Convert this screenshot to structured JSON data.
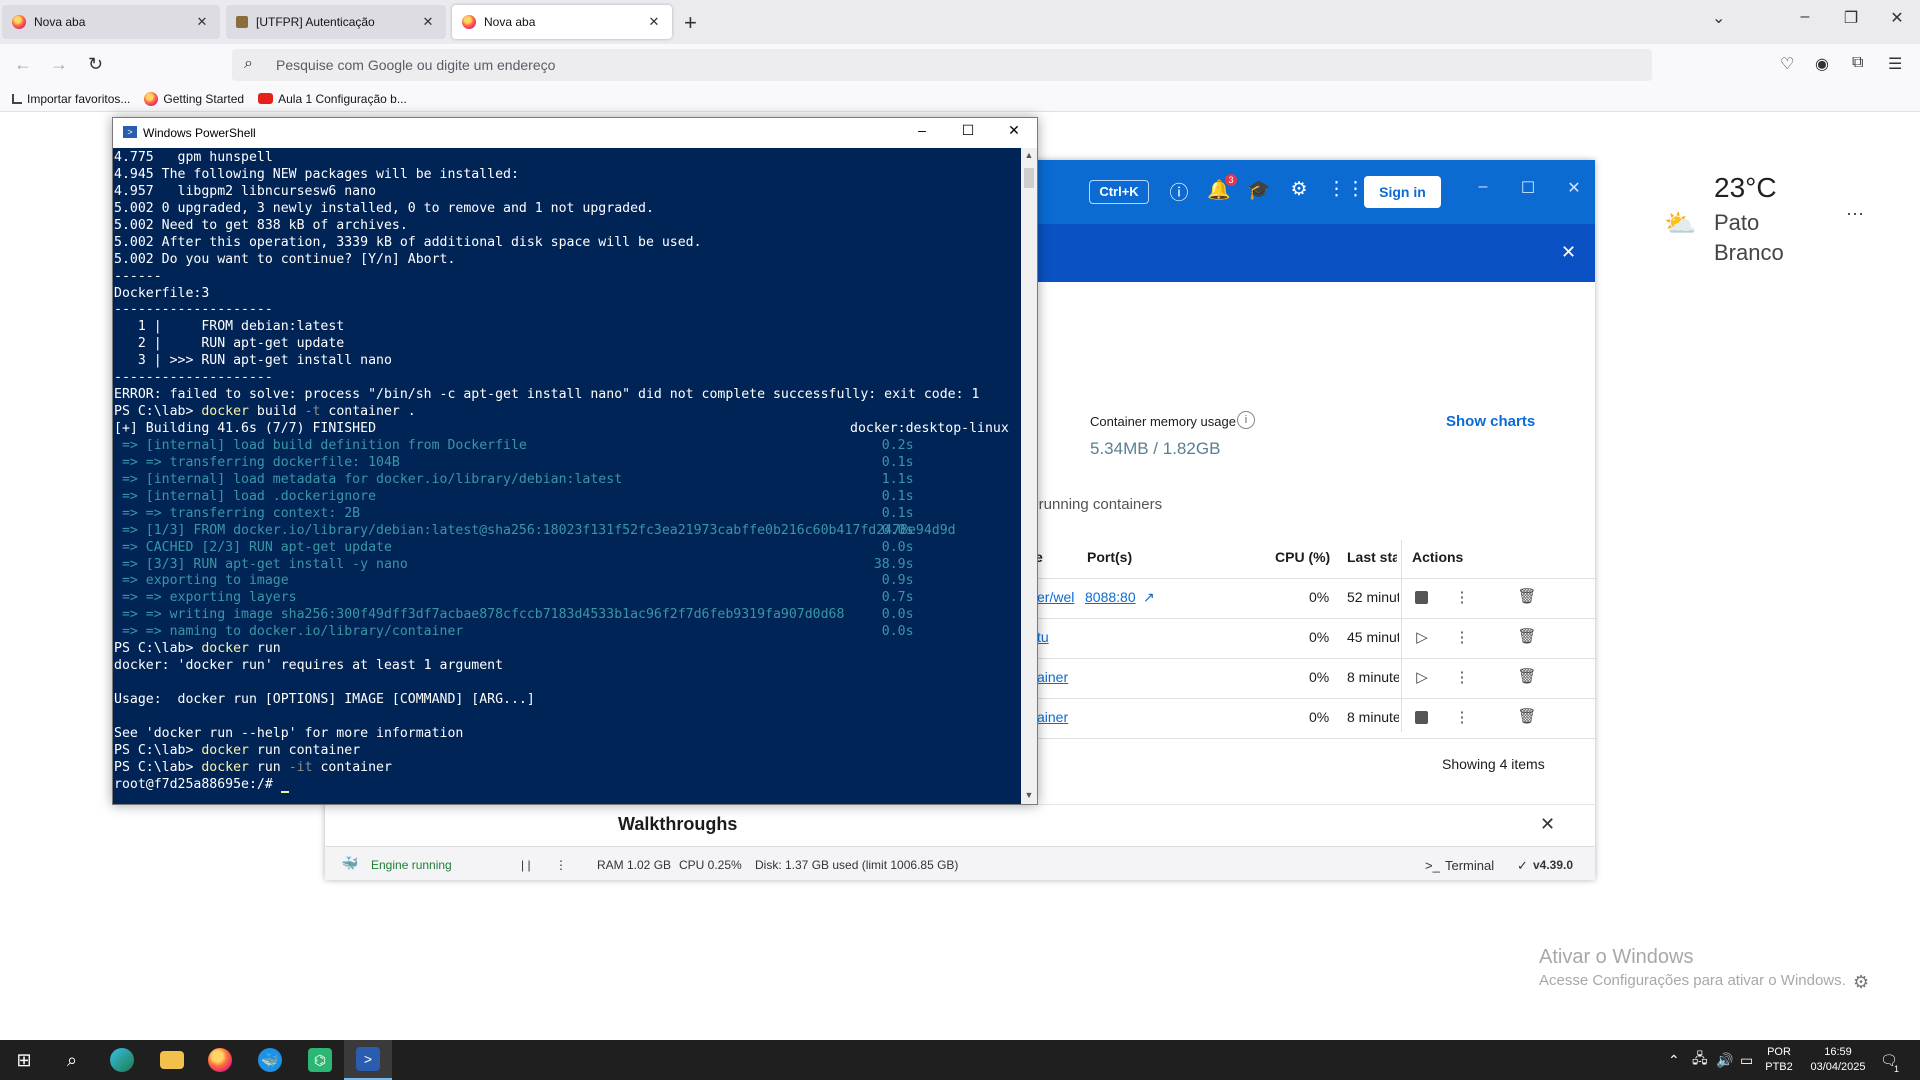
{
  "browser": {
    "tabs": [
      {
        "title": "Nova aba",
        "active": false
      },
      {
        "title": "[UTFPR] Autenticação",
        "active": false
      },
      {
        "title": "Nova aba",
        "active": true
      }
    ],
    "new_tab": "+",
    "url_placeholder": "Pesquise com Google ou digite um endereço",
    "bookmarks": [
      "Importar favoritos...",
      "Getting Started",
      "Aula 1 Configuração b..."
    ]
  },
  "docker": {
    "shortcut": "Ctrl+K",
    "notification_count": "3",
    "sign_in": "Sign in",
    "memory_label": "Container memory usage",
    "memory_value": "5.34MB / 1.82GB",
    "show_charts": "Show charts",
    "running_filter": "v running containers",
    "columns": [
      "e",
      "Port(s)",
      "CPU (%)",
      "Last star",
      "Actions"
    ],
    "rows": [
      {
        "name": "er/wel",
        "port": "8088:80",
        "cpu": "0%",
        "last": "52 minut",
        "state": "running"
      },
      {
        "name": "tu",
        "port": "",
        "cpu": "0%",
        "last": "45 minut",
        "state": "stopped"
      },
      {
        "name": "ainer",
        "port": "",
        "cpu": "0%",
        "last": "8 minute",
        "state": "stopped"
      },
      {
        "name": "ainer",
        "port": "",
        "cpu": "0%",
        "last": "8 minute",
        "state": "running"
      }
    ],
    "showing": "Showing 4 items",
    "walkthroughs": "Walkthroughs",
    "status": {
      "engine": "Engine running",
      "ram": "RAM 1.02 GB",
      "cpu": "CPU 0.25%",
      "disk": "Disk: 1.37 GB used (limit 1006.85 GB)",
      "terminal": "Terminal",
      "version": "v4.39.0"
    }
  },
  "weather": {
    "temp": "23°C",
    "city": "Pato Branco"
  },
  "powershell": {
    "title": "Windows PowerShell",
    "lines": [
      {
        "t": "4.775   gpm hunspell"
      },
      {
        "t": "4.945 The following NEW packages will be installed:"
      },
      {
        "t": "4.957   libgpm2 libncursesw6 nano"
      },
      {
        "t": "5.002 0 upgraded, 3 newly installed, 0 to remove and 1 not upgraded."
      },
      {
        "t": "5.002 Need to get 838 kB of archives."
      },
      {
        "t": "5.002 After this operation, 3339 kB of additional disk space will be used."
      },
      {
        "t": "5.002 Do you want to continue? [Y/n] Abort."
      },
      {
        "t": "------"
      },
      {
        "t": "Dockerfile:3"
      },
      {
        "t": "--------------------"
      },
      {
        "t": "   1 |     FROM debian:latest"
      },
      {
        "t": "   2 |     RUN apt-get update"
      },
      {
        "t": "   3 | >>> RUN apt-get install nano"
      },
      {
        "t": "--------------------"
      },
      {
        "t": "ERROR: failed to solve: process \"/bin/sh -c apt-get install nano\" did not complete successfully: exit code: 1"
      },
      {
        "t": "PS C:\\lab> ",
        "cmd": "docker",
        "args": [
          {
            "t": " build "
          },
          {
            "t": "-t",
            "flag": true
          },
          {
            "t": " container ."
          }
        ]
      },
      {
        "t": "[+] Building 41.6s (7/7) FINISHED",
        "rt": "docker:desktop-linux"
      },
      {
        "t": " => [internal] load build definition from Dockerfile",
        "rt": "    0.2s",
        "teal": true
      },
      {
        "t": " => => transferring dockerfile: 104B",
        "rt": "    0.1s",
        "teal": true
      },
      {
        "t": " => [internal] load metadata for docker.io/library/debian:latest",
        "rt": "    1.1s",
        "teal": true
      },
      {
        "t": " => [internal] load .dockerignore",
        "rt": "    0.1s",
        "teal": true
      },
      {
        "t": " => => transferring context: 2B",
        "rt": "    0.1s",
        "teal": true
      },
      {
        "t": " => [1/3] FROM docker.io/library/debian:latest@sha256:18023f131f52fc3ea21973cabffe0b216c60b417fd2478e94d9d",
        "rt": "    0.0s",
        "teal": true
      },
      {
        "t": " => CACHED [2/3] RUN apt-get update",
        "rt": "    0.0s",
        "teal": true
      },
      {
        "t": " => [3/3] RUN apt-get install -y nano",
        "rt": "   38.9s",
        "teal": true
      },
      {
        "t": " => exporting to image",
        "rt": "    0.9s",
        "teal": true
      },
      {
        "t": " => => exporting layers",
        "rt": "    0.7s",
        "teal": true
      },
      {
        "t": " => => writing image sha256:300f49dff3df7acbae878cfccb7183d4533b1ac96f2f7d6feb9319fa907d0d68",
        "rt": "    0.0s",
        "teal": true
      },
      {
        "t": " => => naming to docker.io/library/container",
        "rt": "    0.0s",
        "teal": true
      },
      {
        "t": "PS C:\\lab> ",
        "cmd": "docker",
        "args": [
          {
            "t": " run"
          }
        ]
      },
      {
        "t": "docker: 'docker run' requires at least 1 argument"
      },
      {
        "t": ""
      },
      {
        "t": "Usage:  docker run [OPTIONS] IMAGE [COMMAND] [ARG...]"
      },
      {
        "t": ""
      },
      {
        "t": "See 'docker run --help' for more information"
      },
      {
        "t": "PS C:\\lab> ",
        "cmd": "docker",
        "args": [
          {
            "t": " run container"
          }
        ]
      },
      {
        "t": "PS C:\\lab> ",
        "cmd": "docker",
        "args": [
          {
            "t": " run "
          },
          {
            "t": "-it",
            "flag": true
          },
          {
            "t": " container"
          }
        ]
      },
      {
        "t": "root@f7d25a88695e:/# ",
        "cursor": true
      }
    ]
  },
  "watermark": {
    "title": "Ativar o Windows",
    "subtitle": "Acesse Configurações para ativar o Windows."
  },
  "taskbar": {
    "lang1": "POR",
    "lang2": "PTB2",
    "time": "16:59",
    "date": "03/04/2025",
    "notifications": "1"
  }
}
